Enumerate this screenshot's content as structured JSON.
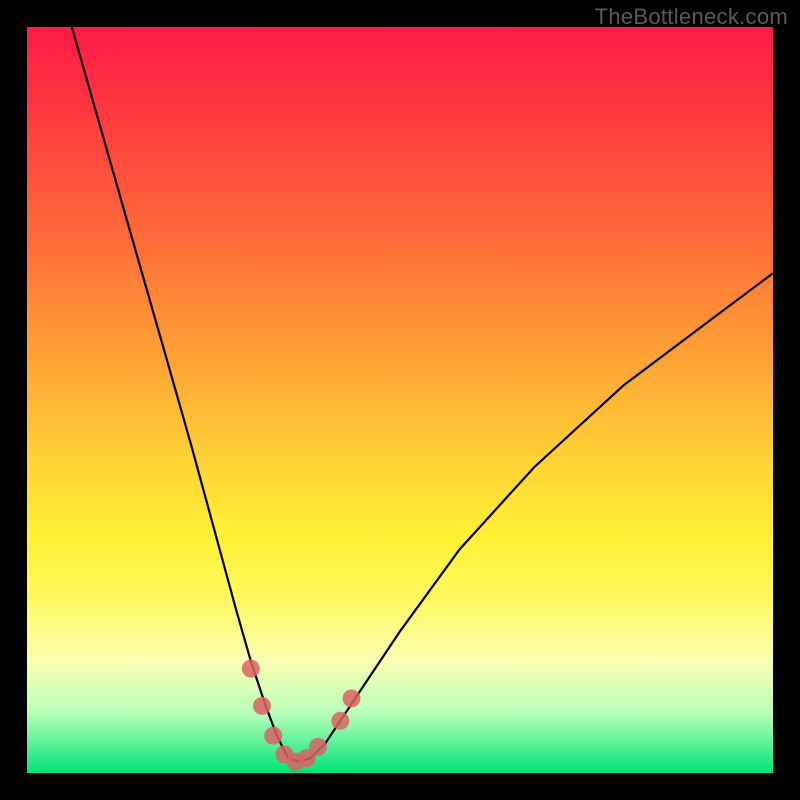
{
  "watermark": "TheBottleneck.com",
  "colors": {
    "frame_bg_top": "#ff1a47",
    "frame_bg_bottom": "#00e37a",
    "curve_stroke": "#000000",
    "marker_stroke": "#d96363"
  },
  "chart_data": {
    "type": "line",
    "title": "",
    "xlabel": "",
    "ylabel": "",
    "xlim": [
      0,
      100
    ],
    "ylim": [
      0,
      100
    ],
    "grid": false,
    "legend": false,
    "series": [
      {
        "name": "bottleneck-curve",
        "x": [
          6,
          10,
          14,
          18,
          22,
          25,
          28,
          30,
          32,
          33.5,
          35,
          36.5,
          38,
          40,
          44,
          50,
          58,
          68,
          80,
          92,
          100
        ],
        "values": [
          100,
          86,
          72,
          58,
          44,
          33,
          22,
          15,
          9,
          5,
          2,
          1.5,
          2,
          4,
          10,
          19,
          30,
          41,
          52,
          61,
          67
        ]
      }
    ],
    "markers": {
      "name": "highlight-band",
      "x": [
        30,
        31.5,
        33,
        34.5,
        36,
        37.5,
        39,
        42,
        43.5
      ],
      "values": [
        14,
        9,
        5,
        2.5,
        1.5,
        2,
        3.5,
        7,
        10
      ]
    }
  }
}
